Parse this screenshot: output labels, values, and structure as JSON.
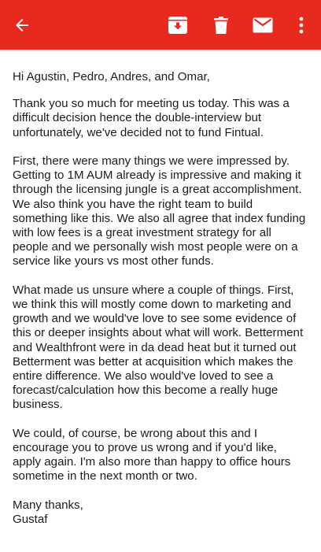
{
  "toolbar": {
    "background_color": "#e8291d",
    "icons": [
      "arrow-back-icon",
      "archive-icon",
      "trash-icon",
      "mail-icon",
      "more-vert-icon"
    ]
  },
  "email": {
    "greeting": "Hi Agustin, Pedro, Andres, and Omar,",
    "paragraphs": [
      "Thank you so much for meeting us today. This was a difficult decision hence the double-interview but unfortunately, we've decided not to fund Fintual.",
      "First, there were many things we were impressed by. Getting to 1M AUM already is impressive and making it through the licensing jungle is a great accomplishment. We also think you have the right team to build something like this. We also all agree that index funding with low fees is a great investment strategy for all people and we personally wish most people were on a service like yours vs most other funds.",
      "What made us unsure where a couple of things. First, we think this will mostly come down to marketing and growth and we would've love to see some evidence of this or deeper insights about what will work. Betterment and Wealthfront were in da dead heat but it turned out Betterment was better at acquisition which makes the entire difference. We also would've loved to see a forecast/calculation how this become a really huge business.",
      "We could, of course, be wrong about this and I encourage you to prove us wrong and if you'd like, apply again. I'm also more than happy to office hours sometime in the next month or two."
    ],
    "closing": "Many thanks,",
    "signature": "Gustaf"
  }
}
